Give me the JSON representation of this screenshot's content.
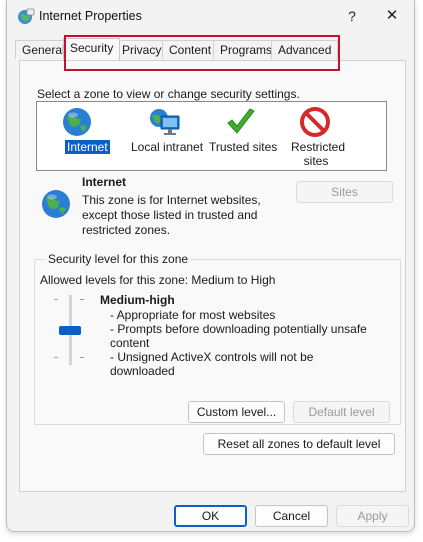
{
  "window": {
    "title": "Internet Properties",
    "help_label": "?",
    "close_label": "✕"
  },
  "tabs": [
    {
      "label": "General"
    },
    {
      "label": "Security"
    },
    {
      "label": "Privacy"
    },
    {
      "label": "Content"
    },
    {
      "label": "Programs"
    },
    {
      "label": "Advanced"
    }
  ],
  "active_tab": "Security",
  "security": {
    "zone_prompt": "Select a zone to view or change security settings.",
    "zones": [
      {
        "label": "Internet",
        "icon": "globe-icon",
        "selected": true
      },
      {
        "label": "Local intranet",
        "icon": "intranet-icon",
        "selected": false
      },
      {
        "label": "Trusted sites",
        "icon": "checkmark-icon",
        "selected": false
      },
      {
        "label": "Restricted sites",
        "icon": "restricted-icon",
        "selected": false
      }
    ],
    "selected_zone": {
      "name": "Internet",
      "description": "This zone is for Internet websites, except those listed in trusted and restricted zones."
    },
    "sites_button": "Sites",
    "level_group_title": "Security level for this zone",
    "allowed_levels": "Allowed levels for this zone: Medium to High",
    "level": {
      "name": "Medium-high",
      "bullets": [
        "- Appropriate for most websites",
        "- Prompts before downloading potentially unsafe content",
        "- Unsigned ActiveX controls will not be downloaded"
      ]
    },
    "custom_level_button": "Custom level...",
    "default_level_button": "Default level",
    "reset_zones_button": "Reset all zones to default level"
  },
  "footer": {
    "ok": "OK",
    "cancel": "Cancel",
    "apply": "Apply"
  },
  "colors": {
    "accent": "#0a5fc9",
    "highlight_box": "#c8102e"
  }
}
